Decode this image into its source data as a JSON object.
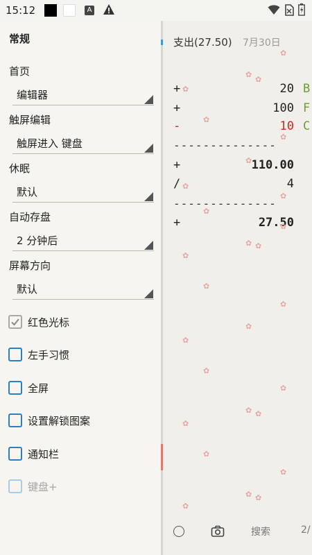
{
  "statusbar": {
    "time": "15:12",
    "icons": [
      "black-square-icon",
      "white-square-icon",
      "a-notification-icon",
      "warning-icon",
      "wifi-icon",
      "no-sim-icon",
      "battery-icon"
    ],
    "a_glyph": "A"
  },
  "drawer": {
    "header": "常规",
    "settings": [
      {
        "label": "首页",
        "value": "编辑器"
      },
      {
        "label": "触屏编辑",
        "value": "触屏进入 键盘"
      },
      {
        "label": "休眠",
        "value": "默认"
      },
      {
        "label": "自动存盘",
        "value": "2 分钟后"
      },
      {
        "label": "屏幕方向",
        "value": "默认"
      }
    ],
    "checkboxes": [
      {
        "label": "红色光标",
        "checked": true,
        "enabled": true
      },
      {
        "label": "左手习惯",
        "checked": false,
        "enabled": true
      },
      {
        "label": "全屏",
        "checked": false,
        "enabled": true
      },
      {
        "label": "设置解锁图案",
        "checked": false,
        "enabled": true
      },
      {
        "label": "通知栏",
        "checked": false,
        "enabled": true
      },
      {
        "label": "键盘+",
        "checked": false,
        "enabled": false
      }
    ]
  },
  "editor": {
    "title": "支出(27.50)",
    "date": "7月30日",
    "lines": [
      {
        "op": "+",
        "value": "20",
        "tag": "B",
        "color": "#222222",
        "tag_color": "#6aa02a",
        "bold": false
      },
      {
        "op": "+",
        "value": "100",
        "tag": "F",
        "color": "#222222",
        "tag_color": "#6aa02a",
        "bold": false
      },
      {
        "op": "-",
        "value": "10",
        "tag": "C",
        "color": "#e02020",
        "tag_color": "#6aa02a",
        "bold": false
      },
      {
        "op": "+",
        "value": "110.00",
        "tag": "",
        "color": "#222222",
        "tag_color": "#222222",
        "bold": true
      },
      {
        "op": "/",
        "value": "4",
        "tag": "",
        "color": "#222222",
        "tag_color": "#222222",
        "bold": false
      },
      {
        "op": "+",
        "value": "27.50",
        "tag": "",
        "color": "#222222",
        "tag_color": "#222222",
        "bold": true
      }
    ],
    "separator": "--------------",
    "bottom": {
      "search_label": "搜索",
      "page_label": "2/"
    }
  },
  "colors": {
    "accent": "#2a80c0",
    "negative": "#e02020",
    "tag_green": "#6aa02a"
  }
}
